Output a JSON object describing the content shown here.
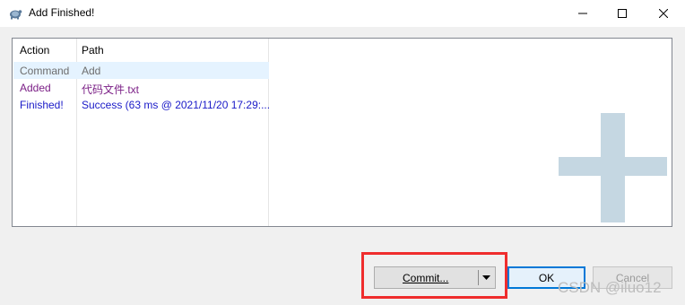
{
  "window": {
    "title": "Add Finished!"
  },
  "list": {
    "columns": {
      "action": "Action",
      "path": "Path"
    },
    "rows": [
      {
        "action": "Command",
        "path": "Add"
      },
      {
        "action": "Added",
        "path": "代码文件.txt"
      },
      {
        "action": "Finished!",
        "path": "Success (63 ms @ 2021/11/20 17:29:..."
      }
    ]
  },
  "buttons": {
    "commit": "Commit...",
    "ok": "OK",
    "cancel": "Cancel"
  },
  "watermark": "CSDN @iluo12",
  "colors": {
    "added": "#7b1f86",
    "finished": "#1a1ac8",
    "highlight": "#ef2d2d",
    "accent": "#0078d7"
  },
  "icons": {
    "app": "tortoise-icon",
    "plus": "add-plus-icon",
    "dropdown": "dropdown-arrow-icon"
  }
}
